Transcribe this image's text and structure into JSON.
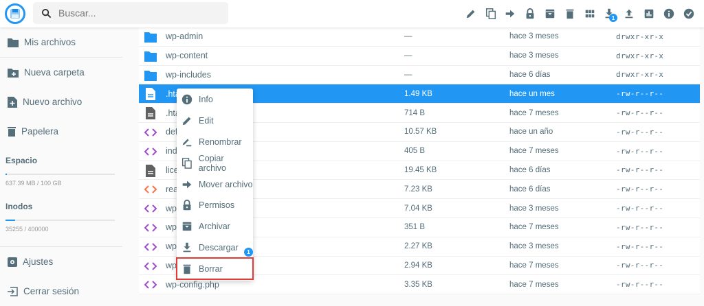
{
  "header": {
    "search_placeholder": "Buscar...",
    "toolbar": [
      {
        "icon": "pencil-icon",
        "label": "Edit"
      },
      {
        "icon": "copy-icon",
        "label": "Copiar"
      },
      {
        "icon": "arrow-right-icon",
        "label": "Mover"
      },
      {
        "icon": "lock-icon",
        "label": "Permisos"
      },
      {
        "icon": "archive-icon",
        "label": "Archivar"
      },
      {
        "icon": "trash-icon",
        "label": "Borrar"
      },
      {
        "icon": "grid-icon",
        "label": "Vista"
      },
      {
        "icon": "download-icon",
        "label": "Descargar",
        "badge": "1"
      },
      {
        "icon": "upload-icon",
        "label": "Subir"
      },
      {
        "icon": "chart-icon",
        "label": "Uso"
      },
      {
        "icon": "info-icon",
        "label": "Info"
      },
      {
        "icon": "check-circle-icon",
        "label": "Seleccionar"
      }
    ]
  },
  "sidebar": {
    "items": [
      {
        "label": "Mis archivos"
      },
      {
        "label": "Nueva carpeta"
      },
      {
        "label": "Nuevo archivo"
      },
      {
        "label": "Papelera"
      }
    ],
    "space": {
      "title": "Espacio",
      "value": "637.39 MB / 100 GB",
      "fraction": 0.006
    },
    "inodes": {
      "title": "Inodos",
      "value": "35255 / 400000",
      "fraction": 0.088
    },
    "settings": "Ajustes",
    "logout": "Cerrar sesión"
  },
  "files": [
    {
      "name": "wp-admin",
      "type": "folder",
      "size": "—",
      "modified": "hace 3 meses",
      "perms": "drwxr-xr-x"
    },
    {
      "name": "wp-content",
      "type": "folder",
      "size": "—",
      "modified": "hace 3 meses",
      "perms": "drwxr-xr-x"
    },
    {
      "name": "wp-includes",
      "type": "folder",
      "size": "—",
      "modified": "hace 6 días",
      "perms": "drwxr-xr-x"
    },
    {
      "name": ".hta",
      "type": "doc",
      "size": "1.49 KB",
      "modified": "hace un mes",
      "perms": "-rw-r--r--",
      "selected": true
    },
    {
      "name": ".hta",
      "type": "doc",
      "size": "714 B",
      "modified": "hace 7 meses",
      "perms": "-rw-r--r--"
    },
    {
      "name": "def",
      "type": "code",
      "size": "10.57 KB",
      "modified": "hace un año",
      "perms": "-rw-r--r--"
    },
    {
      "name": "ind",
      "type": "code",
      "size": "405 B",
      "modified": "hace 7 meses",
      "perms": "-rw-r--r--"
    },
    {
      "name": "lice",
      "type": "doc",
      "size": "19.45 KB",
      "modified": "hace 6 días",
      "perms": "-rw-r--r--"
    },
    {
      "name": "rea",
      "type": "html",
      "size": "7.23 KB",
      "modified": "hace 6 días",
      "perms": "-rw-r--r--"
    },
    {
      "name": "wp",
      "type": "code",
      "size": "7.04 KB",
      "modified": "hace 3 meses",
      "perms": "-rw-r--r--"
    },
    {
      "name": "wp",
      "type": "code",
      "size": "351 B",
      "modified": "hace 7 meses",
      "perms": "-rw-r--r--"
    },
    {
      "name": "wp",
      "type": "code",
      "size": "2.27 KB",
      "modified": "hace 3 meses",
      "perms": "-rw-r--r--"
    },
    {
      "name": "wp",
      "type": "code",
      "size": "2.94 KB",
      "modified": "hace 7 meses",
      "perms": "-rw-r--r--"
    },
    {
      "name": "wp-config.php",
      "type": "code",
      "size": "3.35 KB",
      "modified": "hace 7 meses",
      "perms": "-rw-r--r--"
    }
  ],
  "context_menu": {
    "items": [
      {
        "label": "Info",
        "icon": "info-icon"
      },
      {
        "label": "Edit",
        "icon": "pencil-icon"
      },
      {
        "label": "Renombrar",
        "icon": "rename-icon"
      },
      {
        "label": "Copiar archivo",
        "icon": "copy-icon"
      },
      {
        "label": "Mover archivo",
        "icon": "arrow-right-icon"
      },
      {
        "label": "Permisos",
        "icon": "lock-icon"
      },
      {
        "label": "Archivar",
        "icon": "archive-icon"
      },
      {
        "label": "Descargar",
        "icon": "download-icon"
      },
      {
        "label": "Borrar",
        "icon": "trash-icon",
        "highlighted": true
      }
    ],
    "badge": "1"
  },
  "colors": {
    "accent": "#2196f3",
    "icon": "#546e7a",
    "highlight": "#e53935",
    "code": "#9c4dcc",
    "html": "#ff7043"
  }
}
